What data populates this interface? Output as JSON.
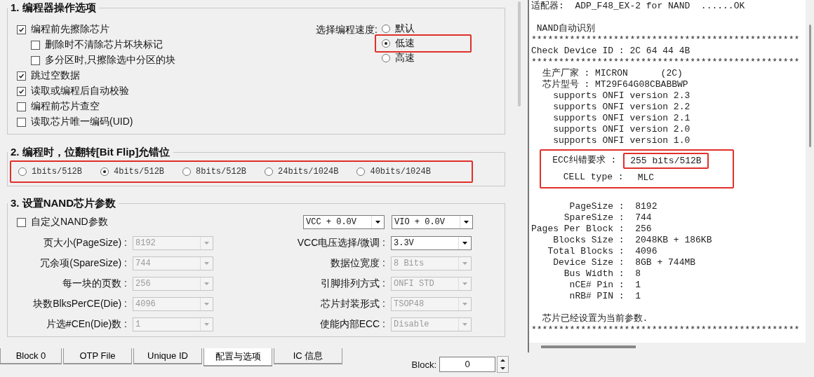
{
  "options_group": {
    "title": "1. 编程器操作选项",
    "checkboxes": [
      {
        "label": "编程前先擦除芯片",
        "checked": true,
        "children": [
          {
            "label": "删除时不清除芯片坏块标记",
            "checked": false
          },
          {
            "label": "多分区时,只擦除选中分区的块",
            "checked": false
          }
        ]
      },
      {
        "label": "跳过空数据",
        "checked": true
      },
      {
        "label": "读取或编程后自动校验",
        "checked": true
      },
      {
        "label": "编程前芯片查空",
        "checked": false
      },
      {
        "label": "读取芯片唯一编码(UID)",
        "checked": false
      }
    ],
    "speed": {
      "label": "选择编程速度:",
      "options": [
        {
          "label": "默认",
          "selected": false,
          "highlighted": false
        },
        {
          "label": "低速",
          "selected": true,
          "highlighted": true
        },
        {
          "label": "高速",
          "selected": false,
          "highlighted": false
        }
      ]
    }
  },
  "bitflip_group": {
    "title": "2. 编程时，位翻转[Bit Flip]允错位",
    "highlighted": true,
    "options": [
      {
        "label": "1bits/512B",
        "selected": false
      },
      {
        "label": "4bits/512B",
        "selected": true
      },
      {
        "label": "8bits/512B",
        "selected": false
      },
      {
        "label": "24bits/1024B",
        "selected": false
      },
      {
        "label": "40bits/1024B",
        "selected": false
      }
    ]
  },
  "nand_group": {
    "title": "3. 设置NAND芯片参数",
    "custom": {
      "label": "自定义NAND参数",
      "checked": false
    },
    "offsets": [
      {
        "value": "VCC + 0.0V",
        "disabled": false
      },
      {
        "value": "VIO + 0.0V",
        "disabled": false
      }
    ],
    "rows": [
      {
        "left": {
          "label": "页大小(PageSize) :",
          "value": "8192",
          "disabled": true
        },
        "right": {
          "label": "VCC电压选择/微调 :",
          "value": "3.3V",
          "disabled": false
        }
      },
      {
        "left": {
          "label": "冗余项(SpareSize) :",
          "value": "744",
          "disabled": true
        },
        "right": {
          "label": "数据位宽度 :",
          "value": "8 Bits",
          "disabled": true
        }
      },
      {
        "left": {
          "label": "每一块的页数 :",
          "value": "256",
          "disabled": true
        },
        "right": {
          "label": "引脚排列方式 :",
          "value": "ONFI STD",
          "disabled": true
        }
      },
      {
        "left": {
          "label": "块数BlksPerCE(Die) :",
          "value": "4096",
          "disabled": true
        },
        "right": {
          "label": "芯片封装形式 :",
          "value": "TSOP48",
          "disabled": true
        }
      },
      {
        "left": {
          "label": "片选#CEn(Die)数 :",
          "value": "1",
          "disabled": true
        },
        "right": {
          "label": "使能内部ECC :",
          "value": "Disable",
          "disabled": true
        }
      }
    ]
  },
  "tabs": [
    {
      "label": "Block 0",
      "selected": false
    },
    {
      "label": "OTP File",
      "selected": false
    },
    {
      "label": "Unique ID",
      "selected": false
    },
    {
      "label": "配置与选项",
      "selected": true
    },
    {
      "label": "IC 信息",
      "selected": false
    }
  ],
  "block_spin": {
    "label": "Block:",
    "value": "0"
  },
  "log": [
    {
      "kind": "text",
      "text": "适配器:  ADP_F48_EX-2 for NAND  ......OK"
    },
    {
      "kind": "blank"
    },
    {
      "kind": "text",
      "text": " NAND自动识别"
    },
    {
      "kind": "text",
      "text": "*************************************************"
    },
    {
      "kind": "text",
      "text": "Check Device ID : 2C 64 44 4B"
    },
    {
      "kind": "text",
      "text": "*************************************************"
    },
    {
      "kind": "text",
      "text": "  生产厂家 : MICRON      (2C)"
    },
    {
      "kind": "text",
      "text": "  芯片型号 : MT29F64G08CBABBWP"
    },
    {
      "kind": "text",
      "text": "    supports ONFI version 2.3"
    },
    {
      "kind": "text",
      "text": "    supports ONFI version 2.2"
    },
    {
      "kind": "text",
      "text": "    supports ONFI version 2.1"
    },
    {
      "kind": "text",
      "text": "    supports ONFI version 2.0"
    },
    {
      "kind": "text",
      "text": "    supports ONFI version 1.0"
    },
    {
      "kind": "highlight",
      "lines": [
        {
          "label": "    ECC纠错要求 :",
          "value": "255 bits/512B",
          "highlighted": true
        },
        {
          "label": "      CELL type :",
          "value": "MLC",
          "highlighted": false
        }
      ]
    },
    {
      "kind": "blank"
    },
    {
      "kind": "text",
      "text": "       PageSize :  8192"
    },
    {
      "kind": "text",
      "text": "      SpareSize :  744"
    },
    {
      "kind": "text",
      "text": "Pages Per Block :  256"
    },
    {
      "kind": "text",
      "text": "    Blocks Size :  2048KB + 186KB"
    },
    {
      "kind": "text",
      "text": "   Total Blocks :  4096"
    },
    {
      "kind": "text",
      "text": "    Device Size :  8GB + 744MB"
    },
    {
      "kind": "text",
      "text": "      Bus Width :  8"
    },
    {
      "kind": "text",
      "text": "       nCE# Pin :  1"
    },
    {
      "kind": "text",
      "text": "       nRB# PIN :  1"
    },
    {
      "kind": "blank"
    },
    {
      "kind": "text",
      "text": "  芯片已经设置为当前参数."
    },
    {
      "kind": "text",
      "text": "*************************************************"
    }
  ]
}
